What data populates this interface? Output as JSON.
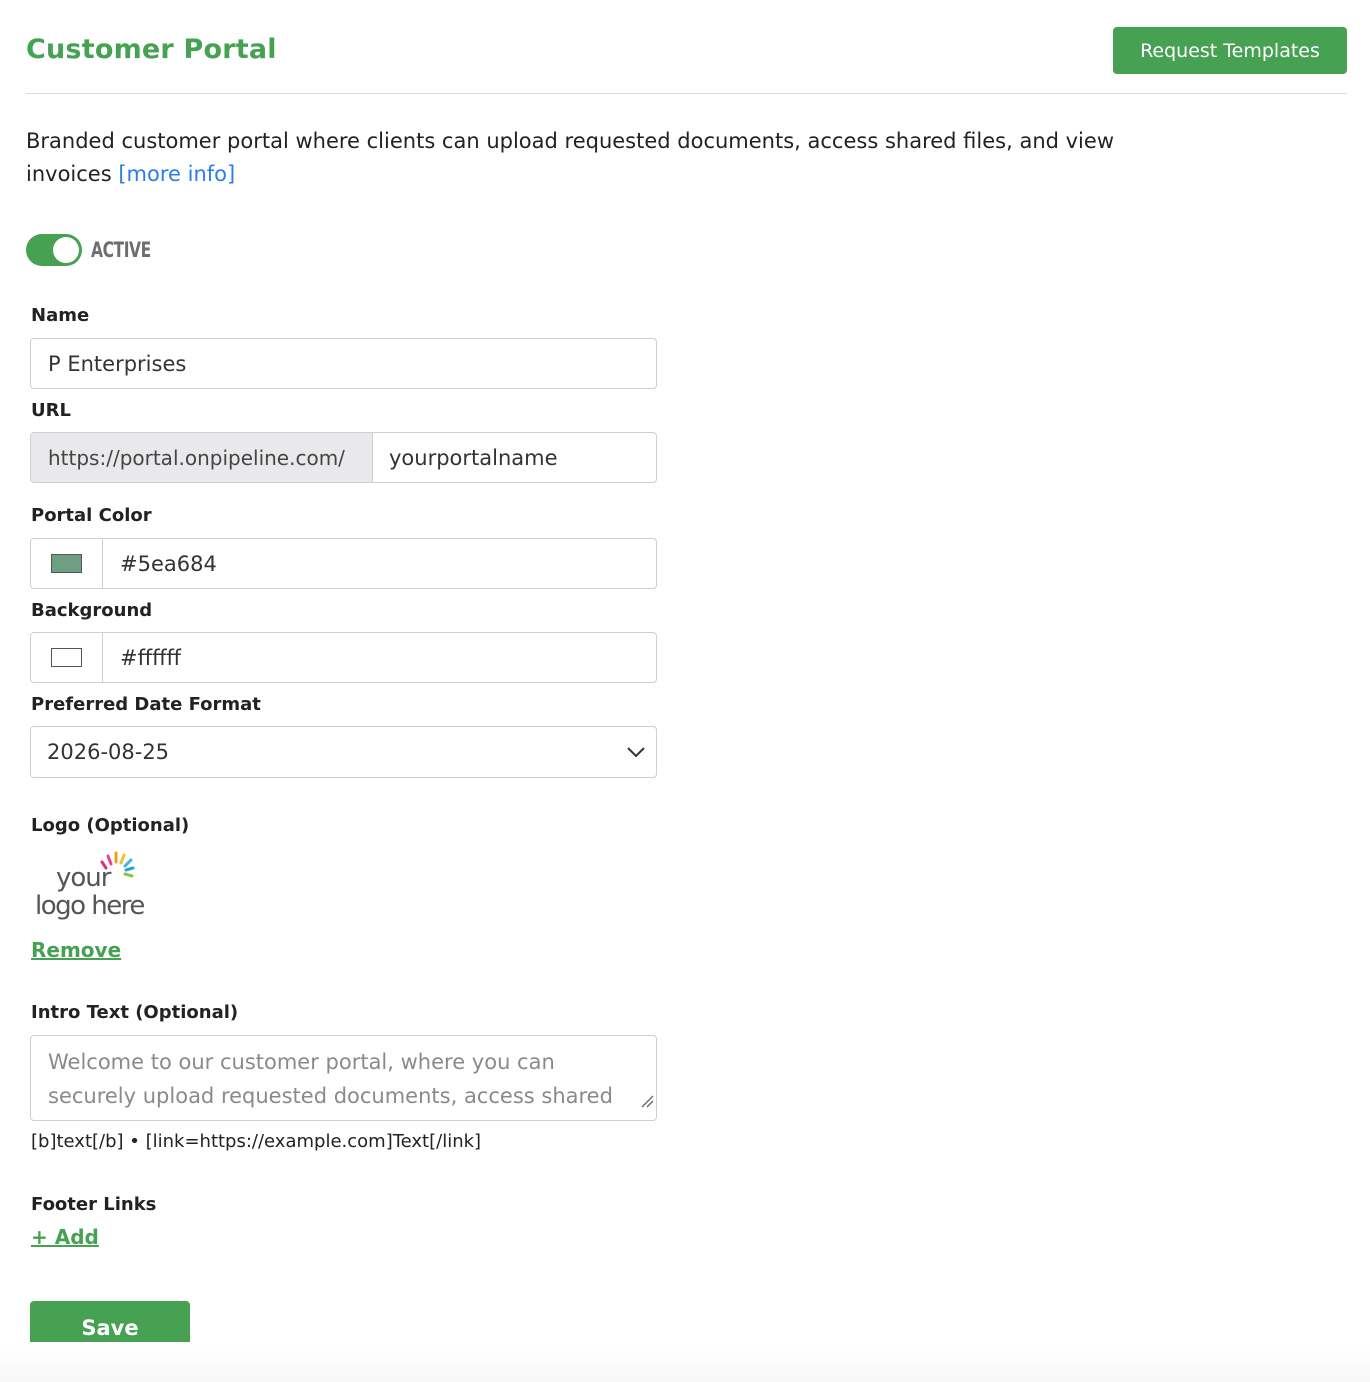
{
  "header": {
    "title": "Customer Portal",
    "request_templates_label": "Request Templates"
  },
  "description": {
    "text": "Branded customer portal where clients can upload requested documents, access shared files, and view invoices",
    "more_info_label": "[more info]"
  },
  "status": {
    "active": true,
    "label": "ACTIVE"
  },
  "form": {
    "name": {
      "label": "Name",
      "value": "P Enterprises"
    },
    "url": {
      "label": "URL",
      "prefix": "https://portal.onpipeline.com/",
      "value": "yourportalname"
    },
    "portal_color": {
      "label": "Portal Color",
      "value": "#5ea684",
      "swatch": "#6e9e84"
    },
    "background": {
      "label": "Background",
      "value": "#ffffff",
      "swatch": "#ffffff"
    },
    "date_format": {
      "label": "Preferred Date Format",
      "value": "2026-08-25"
    },
    "logo": {
      "label": "Logo (Optional)",
      "image_text_line1": "your",
      "image_text_line2": "logo here",
      "remove_label": "Remove"
    },
    "intro_text": {
      "label": "Intro Text (Optional)",
      "value": "Welcome to our customer portal, where you can securely upload requested documents, access shared files and view invoices.",
      "hint": "[b]text[/b] • [link=https://example.com]Text[/link]"
    },
    "footer_links": {
      "label": "Footer Links",
      "add_label": "+ Add"
    }
  },
  "actions": {
    "save_label": "Save"
  },
  "colors": {
    "accent": "#47a152",
    "link": "#2b7de9"
  },
  "icons": [
    "chevron-down-icon",
    "resize-handle-icon"
  ]
}
